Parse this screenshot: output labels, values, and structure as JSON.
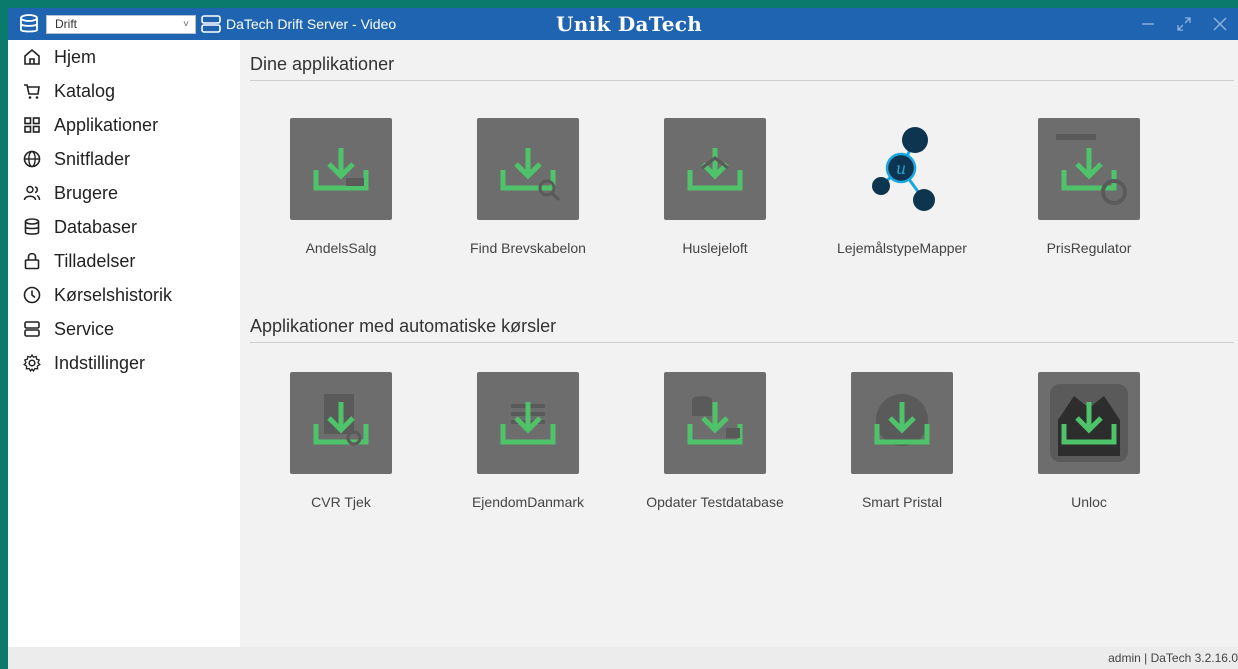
{
  "titlebar": {
    "environment": "Drift",
    "server_title": "DaTech Drift Server - Video",
    "brand": "Unik DaTech"
  },
  "sidebar": {
    "items": [
      {
        "label": "Hjem",
        "icon": "home-icon"
      },
      {
        "label": "Katalog",
        "icon": "cart-icon"
      },
      {
        "label": "Applikationer",
        "icon": "apps-grid-icon"
      },
      {
        "label": "Snitflader",
        "icon": "globe-icon"
      },
      {
        "label": "Brugere",
        "icon": "users-icon"
      },
      {
        "label": "Databaser",
        "icon": "database-icon"
      },
      {
        "label": "Tilladelser",
        "icon": "lock-icon"
      },
      {
        "label": "Kørselshistorik",
        "icon": "clock-icon"
      },
      {
        "label": "Service",
        "icon": "server-icon"
      },
      {
        "label": "Indstillinger",
        "icon": "gear-icon"
      }
    ]
  },
  "sections": {
    "apps": {
      "title": "Dine applikationer",
      "items": [
        {
          "label": "AndelsSalg",
          "icon": "download-tray-icon"
        },
        {
          "label": "Find Brevskabelon",
          "icon": "download-tray-icon"
        },
        {
          "label": "Huslejeloft",
          "icon": "download-tray-icon"
        },
        {
          "label": "LejemålstypeMapper",
          "icon": "network-nodes-icon"
        },
        {
          "label": "PrisRegulator",
          "icon": "download-tray-icon"
        }
      ]
    },
    "auto": {
      "title": "Applikationer med automatiske kørsler",
      "items": [
        {
          "label": "CVR Tjek",
          "icon": "download-tray-icon"
        },
        {
          "label": "EjendomDanmark",
          "icon": "download-tray-icon"
        },
        {
          "label": "Opdater Testdatabase",
          "icon": "download-tray-icon"
        },
        {
          "label": "Smart Pristal",
          "icon": "download-tray-icon"
        },
        {
          "label": "Unloc",
          "icon": "download-tray-icon"
        }
      ]
    }
  },
  "statusbar": {
    "text": "admin | DaTech 3.2.16.0"
  },
  "colors": {
    "titlebar": "#1f64b0",
    "frame": "#0a7a6c",
    "tile": "#6d6d6d",
    "accent_green": "#4fc36a",
    "node_dark": "#0e3550",
    "node_blue": "#1aa6e0"
  }
}
